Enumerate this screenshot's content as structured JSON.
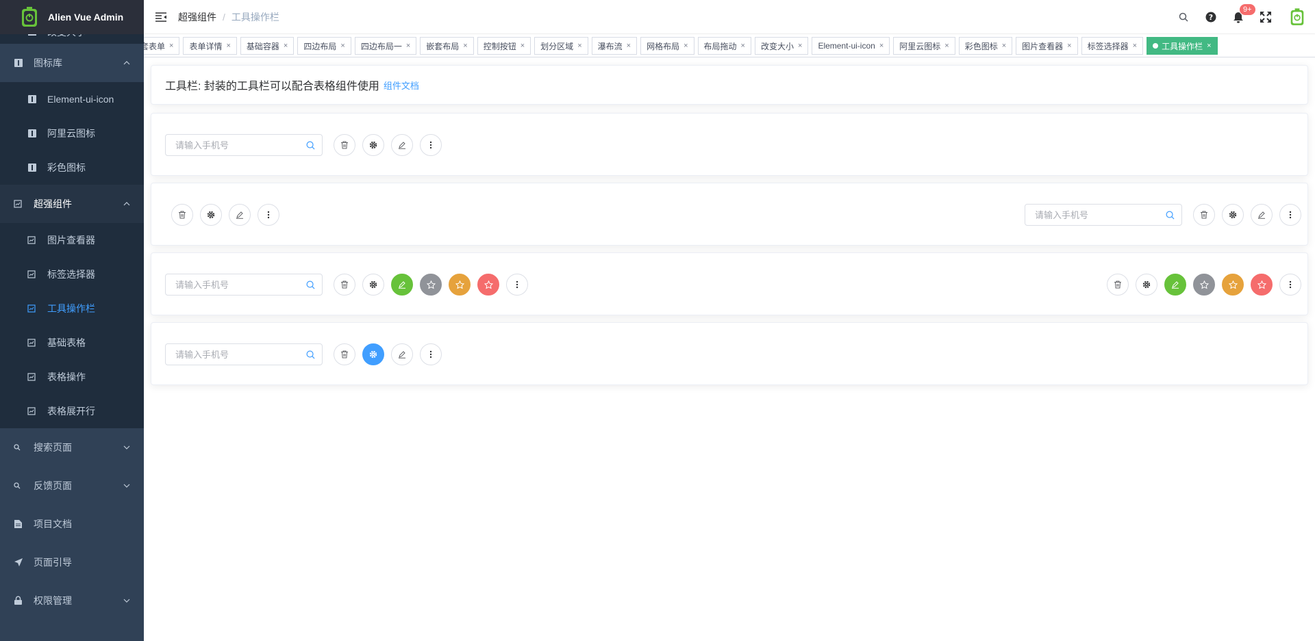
{
  "app": {
    "title": "Alien Vue Admin"
  },
  "sidebar": {
    "items": [
      {
        "label": "改变大小"
      },
      {
        "label": "图标库"
      },
      {
        "label": "Element-ui-icon"
      },
      {
        "label": "阿里云图标"
      },
      {
        "label": "彩色图标"
      },
      {
        "label": "超强组件"
      },
      {
        "label": "图片查看器"
      },
      {
        "label": "标签选择器"
      },
      {
        "label": "工具操作栏"
      },
      {
        "label": "基础表格"
      },
      {
        "label": "表格操作"
      },
      {
        "label": "表格展开行"
      },
      {
        "label": "搜索页面"
      },
      {
        "label": "反馈页面"
      },
      {
        "label": "项目文档"
      },
      {
        "label": "页面引导"
      },
      {
        "label": "权限管理"
      }
    ]
  },
  "header": {
    "breadcrumb": [
      "超强组件",
      "工具操作栏"
    ],
    "separator": "/",
    "notification_badge": "9+"
  },
  "tags": [
    "套表单",
    "表单详情",
    "基础容器",
    "四边布局",
    "四边布局一",
    "嵌套布局",
    "控制按钮",
    "划分区域",
    "瀑布流",
    "网格布局",
    "布局拖动",
    "改变大小",
    "Element-ui-icon",
    "阿里云图标",
    "彩色图标",
    "图片查看器",
    "标签选择器",
    "工具操作栏"
  ],
  "tag_close": "×",
  "intro": {
    "text": "工具栏: 封装的工具栏可以配合表格组件使用",
    "link": "组件文档"
  },
  "search": {
    "placeholder": "请输入手机号"
  },
  "colors": {
    "sidebar": "#304156",
    "active_tag": "#42b983",
    "primary": "#409eff",
    "success": "#67c23a",
    "info": "#909399",
    "warning": "#e6a23c",
    "danger": "#f56c6c"
  }
}
